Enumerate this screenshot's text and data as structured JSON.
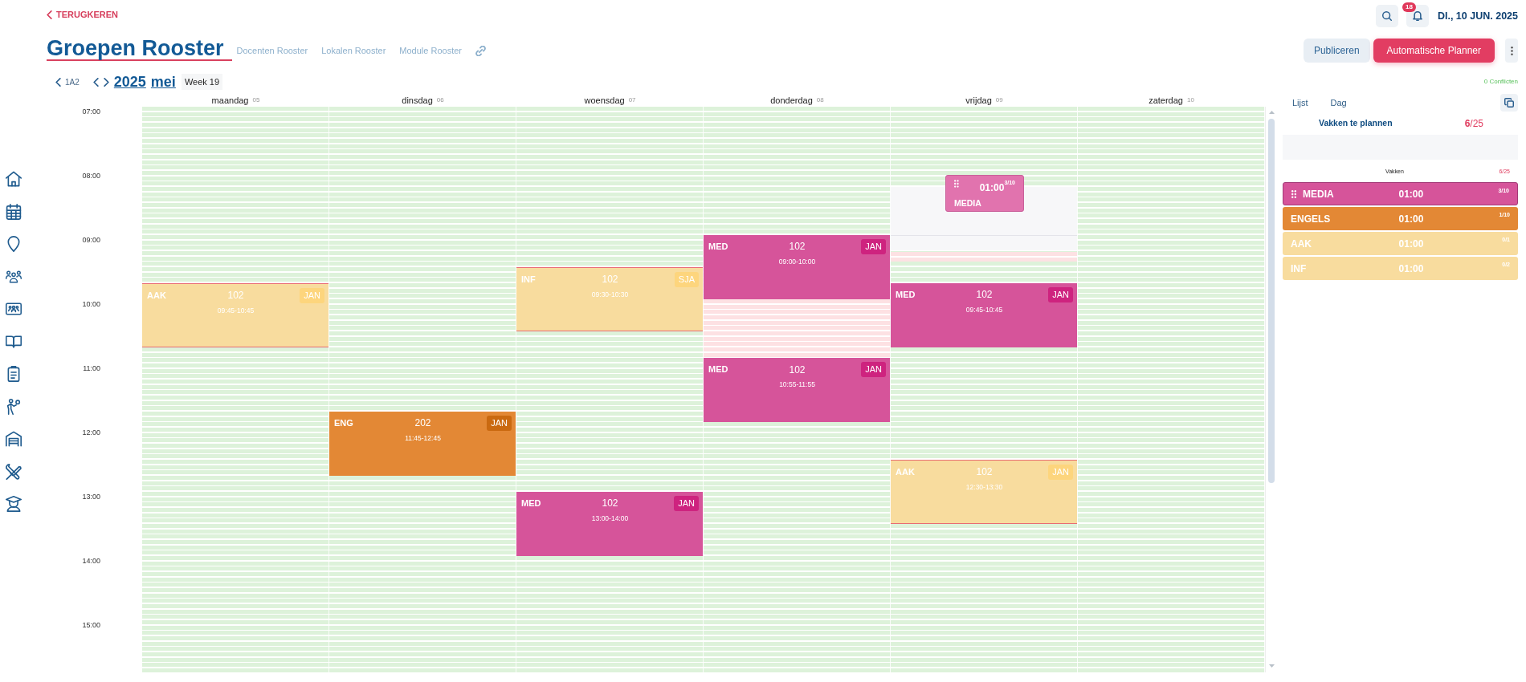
{
  "header": {
    "back": "TERUGKEREN",
    "title": "Groepen Rooster",
    "links": [
      "Docenten Rooster",
      "Lokalen Rooster",
      "Module Rooster"
    ],
    "notifications": "18",
    "date": "DI., 10 JUN. 2025"
  },
  "actions": [
    {
      "label": "Publiceren",
      "kind": "secondary"
    },
    {
      "label": "Automatische Planner",
      "kind": "primary"
    }
  ],
  "nav": {
    "group": "1A2",
    "year": "2025",
    "month": "mei",
    "week": "Week 19",
    "conflicts": "0 Conflicten"
  },
  "calendar": {
    "hours": [
      "07:00",
      "08:00",
      "09:00",
      "10:00",
      "11:00",
      "12:00",
      "13:00",
      "14:00",
      "15:00"
    ],
    "days": [
      {
        "name": "maandag",
        "date": "05",
        "conflict": false,
        "events": [
          {
            "subject": "AAK",
            "room": "102",
            "teacher": "JAN",
            "time": "09:45-10:45",
            "color": "#f8dc9e",
            "outlined": true
          }
        ]
      },
      {
        "name": "dinsdag",
        "date": "06",
        "conflict": false,
        "events": [
          {
            "subject": "ENG",
            "room": "202",
            "teacher": "JAN",
            "time": "11:45-12:45",
            "color": "#e38835",
            "outlined": false
          }
        ]
      },
      {
        "name": "woensdag",
        "date": "07",
        "conflict": false,
        "events": [
          {
            "subject": "INF",
            "room": "102",
            "teacher": "SJA",
            "time": "09:30-10:30",
            "color": "#f8dc9e",
            "outlined": true
          },
          {
            "subject": "MED",
            "room": "102",
            "teacher": "JAN",
            "time": "13:00-14:00",
            "color": "#d6549a",
            "outlined": false
          }
        ]
      },
      {
        "name": "donderdag",
        "date": "08",
        "conflict": true,
        "events": [
          {
            "subject": "MED",
            "room": "102",
            "teacher": "JAN",
            "time": "09:00-10:00",
            "color": "#d6549a",
            "outlined": false
          },
          {
            "subject": "MED",
            "room": "102",
            "teacher": "JAN",
            "time": "10:55-11:55",
            "color": "#d6549a",
            "outlined": false
          }
        ]
      },
      {
        "name": "vrijdag",
        "date": "09",
        "conflict": false,
        "drag_ghost": {
          "duration": "01:00",
          "count": "3/10",
          "subject": "MEDIA"
        },
        "events": [
          {
            "subject": "MED",
            "room": "102",
            "teacher": "JAN",
            "time": "09:45-10:45",
            "color": "#d6549a",
            "outlined": false
          },
          {
            "subject": "AAK",
            "room": "102",
            "teacher": "JAN",
            "time": "12:30-13:30",
            "color": "#f8dc9e",
            "outlined": true
          }
        ]
      },
      {
        "name": "zaterdag",
        "date": "10",
        "conflict": false
      }
    ]
  },
  "panel": {
    "tabs": [
      "Lijst",
      "Dag"
    ],
    "title": "Vakken te plannen",
    "count": "**6**/25",
    "list_label": "Vakken",
    "list_count": "6/25",
    "items": [
      {
        "subject": "MEDIA",
        "duration": "01:00",
        "count": "3/10",
        "color": "#d6549a",
        "dragging": true
      },
      {
        "subject": "ENGELS",
        "duration": "01:00",
        "count": "1/10",
        "color": "#e38835",
        "dragging": false
      },
      {
        "subject": "AAK",
        "duration": "01:00",
        "count": "0/1",
        "color": "#f8dc9e",
        "dragging": false
      },
      {
        "subject": "INF",
        "duration": "01:00",
        "count": "0/2",
        "color": "#f8dc9e",
        "dragging": false
      }
    ]
  }
}
